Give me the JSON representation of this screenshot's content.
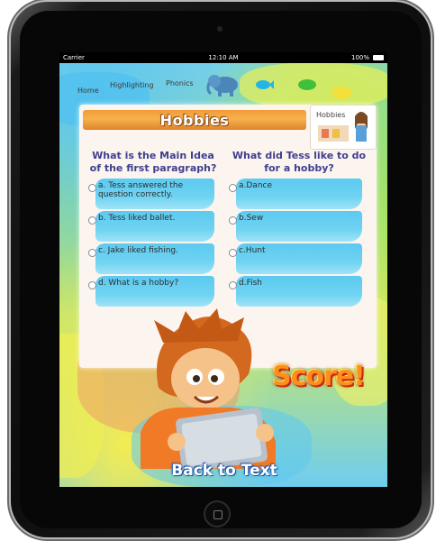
{
  "status_bar": {
    "carrier": "Carrier",
    "time": "12:10 AM",
    "battery": "100%"
  },
  "nav": {
    "home": "Home",
    "highlighting": "Highlighting",
    "phonics": "Phonics"
  },
  "title": "Hobbies",
  "thumbnail_label": "Hobbies",
  "question1": {
    "text": "What is the Main Idea of the first paragraph?",
    "answers": [
      "a. Tess answered the question correctly.",
      "b. Tess liked ballet.",
      "c. Jake liked fishing.",
      "d. What is a hobby?"
    ]
  },
  "question2": {
    "text": "What did Tess like to do for a hobby?",
    "answers": [
      "a.Dance",
      "b.Sew",
      "c.Hunt",
      "d.Fish"
    ]
  },
  "score_label": "Score!",
  "back_button": "Back to Text",
  "colors": {
    "answer_band": "#3fc2f0",
    "question_text": "#3f3f8e",
    "title_banner": "#f29a3a"
  }
}
